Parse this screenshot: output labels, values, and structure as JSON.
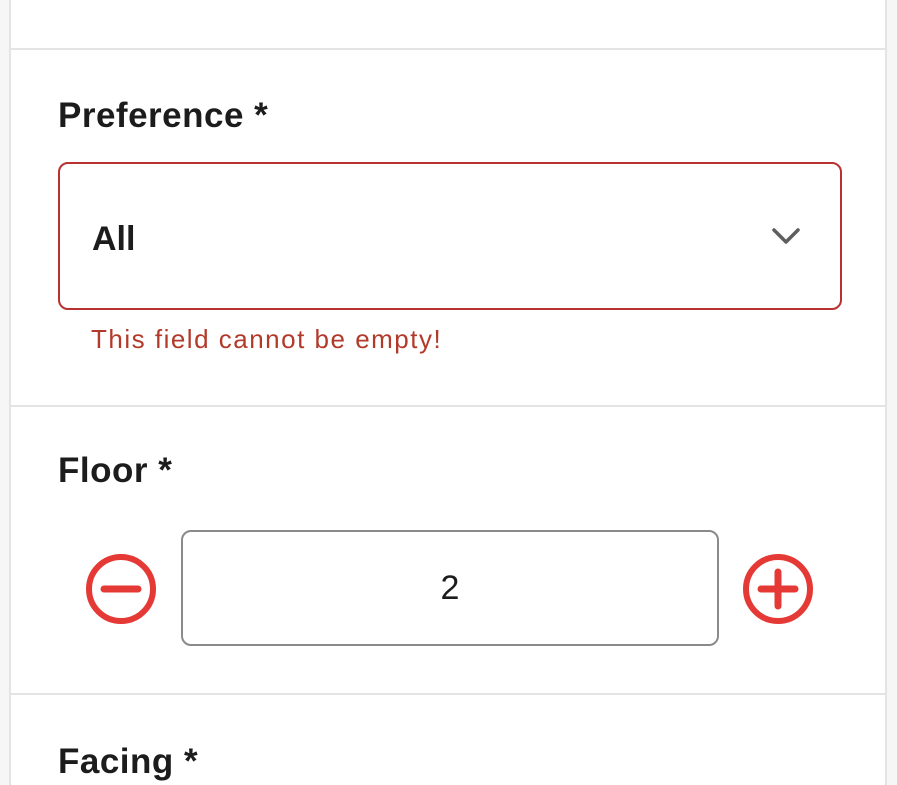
{
  "preference": {
    "label": "Preference *",
    "selected_value": "All",
    "error_message": "This field cannot be empty!",
    "error_color": "#b83232"
  },
  "floor": {
    "label": "Floor *",
    "value": "2",
    "decrement_icon": "minus-circle-icon",
    "increment_icon": "plus-circle-icon",
    "icon_color": "#e53935"
  },
  "facing": {
    "label": "Facing *"
  }
}
